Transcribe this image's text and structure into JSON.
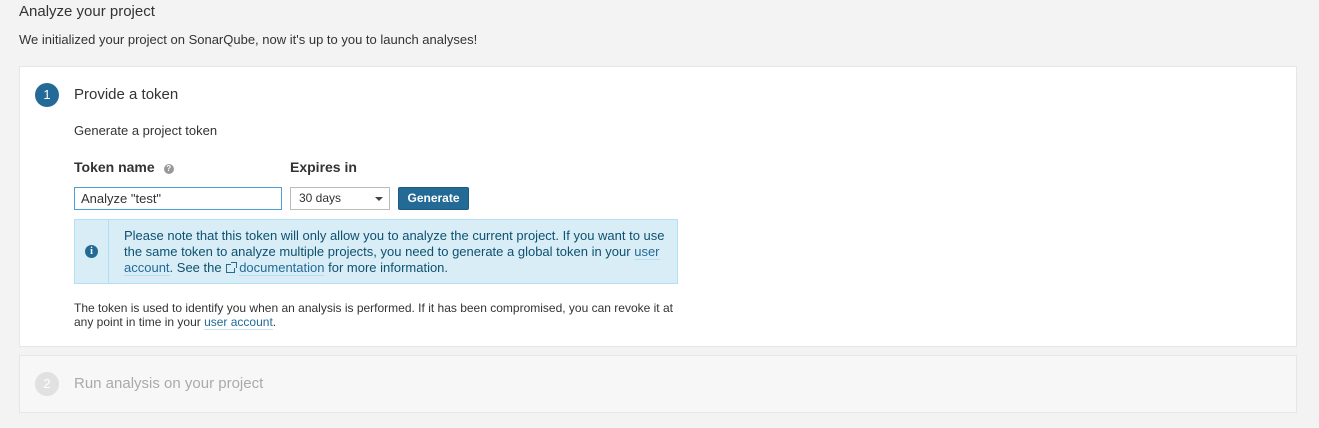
{
  "page": {
    "title": "Analyze your project",
    "description": "We initialized your project on SonarQube, now it's up to you to launch analyses!"
  },
  "step1": {
    "number": "1",
    "title": "Provide a token",
    "subheading": "Generate a project token",
    "token_label": "Token name",
    "help_icon": "?",
    "token_value": "Analyze \"test\"",
    "expires_label": "Expires in",
    "expires_value": "30 days",
    "generate_label": "Generate",
    "info": {
      "icon": "i",
      "text1": "Please note that this token will only allow you to analyze the current project. If you want to use the same token to analyze multiple projects, you need to generate a global token in your ",
      "link1": "user account",
      "text2": ". See the ",
      "link2": "documentation",
      "text3": " for more information."
    },
    "footer": {
      "text1": "The token is used to identify you when an analysis is performed. If it has been compromised, you can revoke it at any point in time in your ",
      "link": "user account",
      "text2": "."
    }
  },
  "step2": {
    "number": "2",
    "title": "Run analysis on your project"
  },
  "colors": {
    "accent": "#236a97",
    "info_bg": "#d9edf7",
    "info_border": "#b1dff3",
    "disabled_step": "#e1e1e1"
  }
}
